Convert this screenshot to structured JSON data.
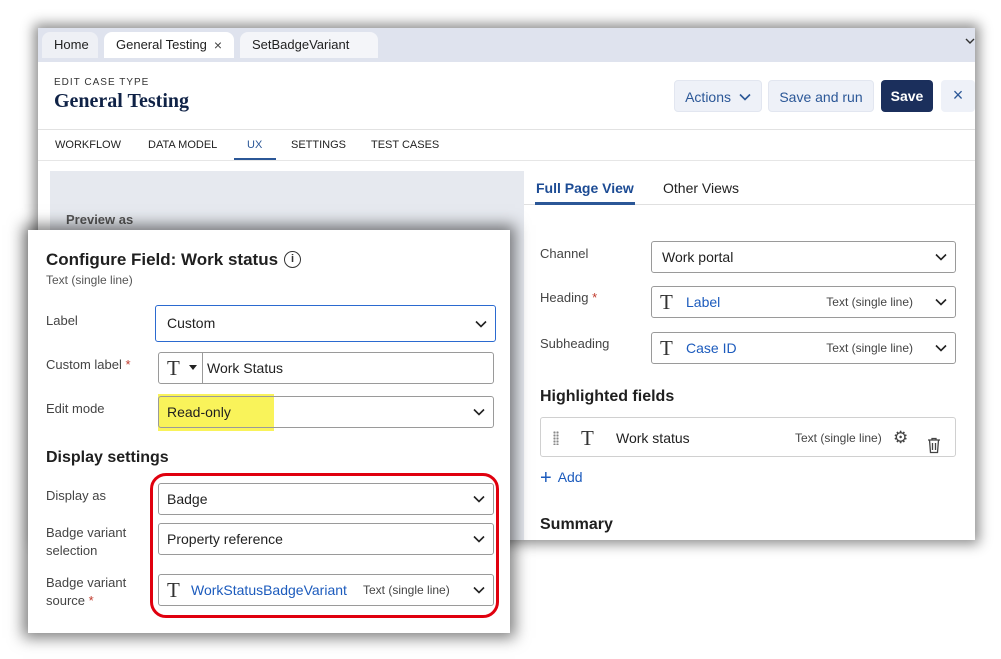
{
  "tabs": [
    {
      "label": "Home"
    },
    {
      "label": "General Testing",
      "close": "×"
    },
    {
      "label": "SetBadgeVariant"
    }
  ],
  "header": {
    "eyebrow": "EDIT CASE TYPE",
    "title": "General Testing",
    "actions_label": "Actions",
    "save_run_label": "Save and run",
    "save_label": "Save",
    "close_glyph": "×"
  },
  "nav": [
    "WORKFLOW",
    "DATA MODEL",
    "UX",
    "SETTINGS",
    "TEST CASES"
  ],
  "nav_active": "UX",
  "preview": {
    "preview_as": "Preview as"
  },
  "right_panel": {
    "tabs": [
      "Full Page View",
      "Other Views"
    ],
    "channel_label": "Channel",
    "channel_value": "Work portal",
    "heading_label": "Heading",
    "heading_value": "Label",
    "heading_type": "Text (single line)",
    "subheading_label": "Subheading",
    "subheading_value": "Case ID",
    "subheading_type": "Text (single line)",
    "highlighted_title": "Highlighted fields",
    "highlighted_field": {
      "name": "Work status",
      "type": "Text (single line)"
    },
    "add_label": "Add",
    "summary_title": "Summary"
  },
  "modal": {
    "title": "Configure Field: Work status",
    "subtitle": "Text (single line)",
    "label_label": "Label",
    "label_value": "Custom",
    "custom_label_label": "Custom label",
    "custom_label_value": "Work Status",
    "edit_mode_label": "Edit mode",
    "edit_mode_value": "Read-only",
    "display_settings_title": "Display settings",
    "display_as_label": "Display as",
    "display_as_value": "Badge",
    "badge_selection_label_1": "Badge variant",
    "badge_selection_label_2": "selection",
    "badge_selection_value": "Property reference",
    "badge_source_label_1": "Badge variant",
    "badge_source_label_2": "source",
    "badge_source_value": "WorkStatusBadgeVariant",
    "badge_source_type": "Text (single line)"
  },
  "required_mark": "*",
  "text_type_glyph": "T",
  "colors": {
    "accent": "#2b5797",
    "save_bg": "#1b2f5c",
    "link": "#1c5bbd",
    "highlight": "#f9f35a",
    "ring": "#e0000e"
  }
}
